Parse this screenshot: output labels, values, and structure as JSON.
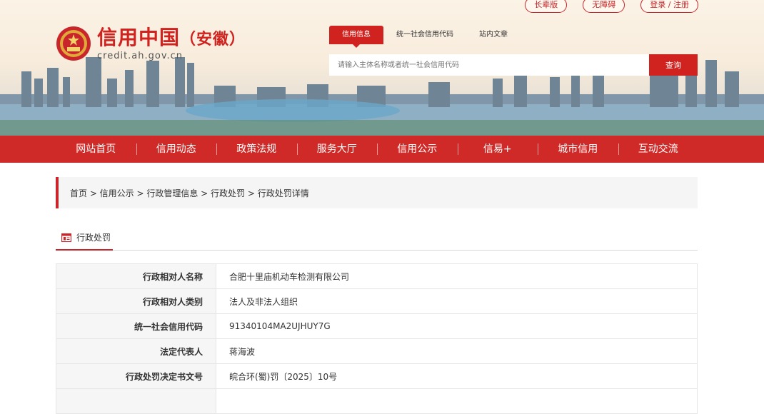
{
  "top_links": [
    "长辈版",
    "无障碍",
    "登录 / 注册"
  ],
  "logo": {
    "cn": "信用中国",
    "sub": "（安徽）",
    "url": "credit.ah.gov.cn"
  },
  "search": {
    "tabs": [
      "信用信息",
      "统一社会信用代码",
      "站内文章"
    ],
    "placeholder": "请输入主体名称或者统一社会信用代码",
    "button": "查询"
  },
  "nav": [
    "网站首页",
    "信用动态",
    "政策法规",
    "服务大厅",
    "信用公示",
    "信易+",
    "城市信用",
    "互动交流"
  ],
  "breadcrumb": "首页 > 信用公示 >  行政管理信息 >  行政处罚 > 行政处罚详情",
  "section_title": "行政处罚",
  "details": [
    {
      "label": "行政相对人名称",
      "value": "合肥十里庙机动车检测有限公司"
    },
    {
      "label": "行政相对人类别",
      "value": "法人及非法人组织"
    },
    {
      "label": "统一社会信用代码",
      "value": "91340104MA2UJHUY7G"
    },
    {
      "label": "法定代表人",
      "value": "蒋海波"
    },
    {
      "label": "行政处罚决定书文号",
      "value": "皖合环(蜀)罚〔2025〕10号"
    },
    {
      "label": "",
      "value": ""
    }
  ],
  "colors": {
    "brand_red": "#cf2a27",
    "accent_red": "#d0221e"
  }
}
